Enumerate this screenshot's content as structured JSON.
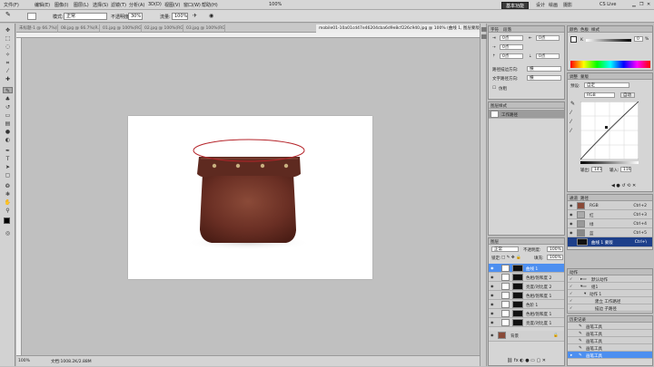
{
  "menubar": {
    "items": [
      "文件(F)",
      "编辑(E)",
      "图像(I)",
      "图层(L)",
      "选择(S)",
      "滤镜(T)",
      "分析(A)",
      "3D(D)",
      "视图(V)",
      "窗口(W)",
      "帮助(H)"
    ],
    "zoom": "100%",
    "workspace_button": "基本功能",
    "workspace_links": [
      "设计",
      "绘画",
      "摄影"
    ],
    "cslive": "CS Live"
  },
  "options": {
    "mode_label": "模式:",
    "mode_value": "正常",
    "opacity_label": "不透明度:",
    "opacity_value": "30%",
    "flow_label": "流量:",
    "flow_value": "100%"
  },
  "tabs": [
    {
      "label": "未标题-1 @ 66.7%(R...",
      "active": false
    },
    {
      "label": "08.jpg @ 66.7%(R...",
      "active": false
    },
    {
      "label": "01.jpg @ 100%(RG...",
      "active": false
    },
    {
      "label": "02.jpg @ 100%(RG...",
      "active": false
    },
    {
      "label": "03.jpg @ 100%(RG...",
      "active": false
    },
    {
      "label": "mobile01-10a01cd47e46204cba6d9e8cf226c940.jpg @ 100% (曲线 1, 图层蒙版/8) *",
      "active": true
    }
  ],
  "status": {
    "zoom": "100%",
    "doc": "文档:1008.2K/2.88M"
  },
  "adjustments": {
    "tabs": [
      "字符",
      "段落"
    ],
    "rows": [
      {
        "label": "0点",
        "value": "0点"
      },
      {
        "label": "0点",
        "value": "0点"
      },
      {
        "label": "0点",
        "value": "0点"
      }
    ],
    "smooth_label": "锐利",
    "line1_label": "路径描边方向:",
    "line1_value": "横",
    "line2_label": "文字路径方向:",
    "line2_value": "横",
    "checkbox": "仿粗",
    "adjust_tab": "图层样式",
    "adjust_item": "工作路径"
  },
  "color_panel": {
    "tabs": [
      "颜色",
      "色板",
      "样式"
    ],
    "k_label": "K",
    "k_value": "0",
    "percent": "%"
  },
  "curves": {
    "tabs": [
      "调整",
      "蒙版"
    ],
    "preset_label": "预设:",
    "preset_value": "自定",
    "channel": "RGB",
    "auto_button": "自动",
    "output_label": "输出:",
    "output_value": "141",
    "input_label": "输入:",
    "input_value": "116"
  },
  "channels": {
    "tabs": [
      "通道",
      "路径"
    ],
    "rows": [
      {
        "name": "RGB",
        "shortcut": "Ctrl+2"
      },
      {
        "name": "红",
        "shortcut": "Ctrl+3"
      },
      {
        "name": "绿",
        "shortcut": "Ctrl+4"
      },
      {
        "name": "蓝",
        "shortcut": "Ctrl+5"
      },
      {
        "name": "曲线 1 蒙版",
        "shortcut": "Ctrl+\\"
      }
    ]
  },
  "layers": {
    "tabs": [
      "图层"
    ],
    "blend": "正常",
    "opacity_label": "不透明度:",
    "opacity_value": "100%",
    "lock_label": "锁定:",
    "fill_label": "填充:",
    "fill_value": "100%",
    "rows": [
      {
        "name": "曲线 1",
        "selected": true
      },
      {
        "name": "色相/饱和度 2",
        "selected": false
      },
      {
        "name": "亮度/对比度 2",
        "selected": false
      },
      {
        "name": "色相/饱和度 1",
        "selected": false
      },
      {
        "name": "色阶 1",
        "selected": false
      },
      {
        "name": "色相/饱和度 1",
        "selected": false
      },
      {
        "name": "亮度/对比度 1",
        "selected": false
      },
      {
        "name": "背景",
        "selected": false
      }
    ]
  },
  "actions": {
    "tabs": [
      "动作"
    ],
    "rows": [
      "默认动作",
      "组1",
      "动作 1",
      "建立 工作路径",
      "描边 子路径"
    ]
  },
  "history": {
    "tabs": [
      "历史记录"
    ],
    "rows": [
      "画笔工具",
      "画笔工具",
      "画笔工具",
      "画笔工具",
      "画笔工具"
    ]
  },
  "colors": {
    "selection": "#4d8ff0",
    "bag": "#6e3326",
    "ellipse": "#b5242a"
  }
}
